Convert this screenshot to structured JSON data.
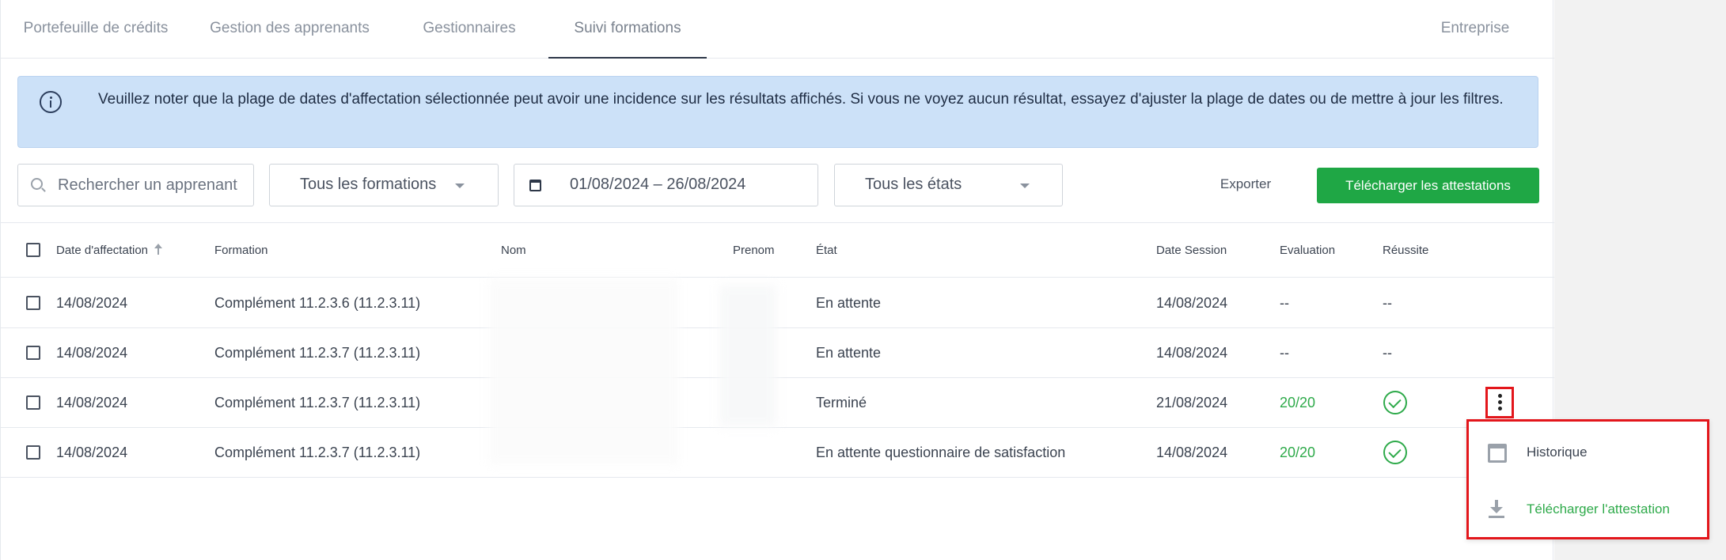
{
  "tabs": [
    {
      "label": "Portefeuille de crédits",
      "active": false
    },
    {
      "label": "Gestion des apprenants",
      "active": false
    },
    {
      "label": "Gestionnaires",
      "active": false
    },
    {
      "label": "Suivi formations",
      "active": true
    },
    {
      "label": "Entreprise",
      "active": false
    }
  ],
  "banner": {
    "icon": "info-icon",
    "text": "Veuillez noter que la plage de dates d'affectation sélectionnée peut avoir une incidence sur les résultats affichés. Si vous ne voyez aucun résultat, essayez d'ajuster la plage de dates ou de mettre à jour les filtres."
  },
  "filters": {
    "search_placeholder": "Rechercher un apprenant",
    "formations": "Tous les formations",
    "date_range": "01/08/2024 – 26/08/2024",
    "etats": "Tous les états",
    "export_label": "Exporter",
    "download_label": "Télécharger les attestations"
  },
  "table": {
    "headers": [
      "Date d'affectation",
      "Formation",
      "Nom",
      "Prenom",
      "État",
      "Date Session",
      "Evaluation",
      "Réussite"
    ],
    "rows": [
      {
        "date": "14/08/2024",
        "formation": "Complément 11.2.3.6 (11.2.3.11)",
        "nom": "",
        "prenom": "",
        "etat": "En attente",
        "session": "14/08/2024",
        "evaluation": "--",
        "reussite": "--"
      },
      {
        "date": "14/08/2024",
        "formation": "Complément 11.2.3.7 (11.2.3.11)",
        "nom": "",
        "prenom": "",
        "etat": "En attente",
        "session": "14/08/2024",
        "evaluation": "--",
        "reussite": "--"
      },
      {
        "date": "14/08/2024",
        "formation": "Complément 11.2.3.7 (11.2.3.11)",
        "nom": "",
        "prenom": "",
        "etat": "Terminé",
        "session": "21/08/2024",
        "evaluation": "20/20",
        "reussite": "check-circle-icon"
      },
      {
        "date": "14/08/2024",
        "formation": "Complément 11.2.3.7 (11.2.3.11)",
        "nom": "",
        "prenom": "",
        "etat": "En attente questionnaire de satisfaction",
        "session": "14/08/2024",
        "evaluation": "20/20",
        "reussite": "check-circle-icon"
      }
    ]
  },
  "row_menu": {
    "items": [
      {
        "label": "Historique",
        "icon": "calendar-icon"
      },
      {
        "label": "Télécharger l'attestation",
        "icon": "download-icon"
      }
    ]
  },
  "colors": {
    "accent_green": "#1fa745",
    "banner_bg": "#cce1f8",
    "highlight_red": "#e3161b"
  }
}
